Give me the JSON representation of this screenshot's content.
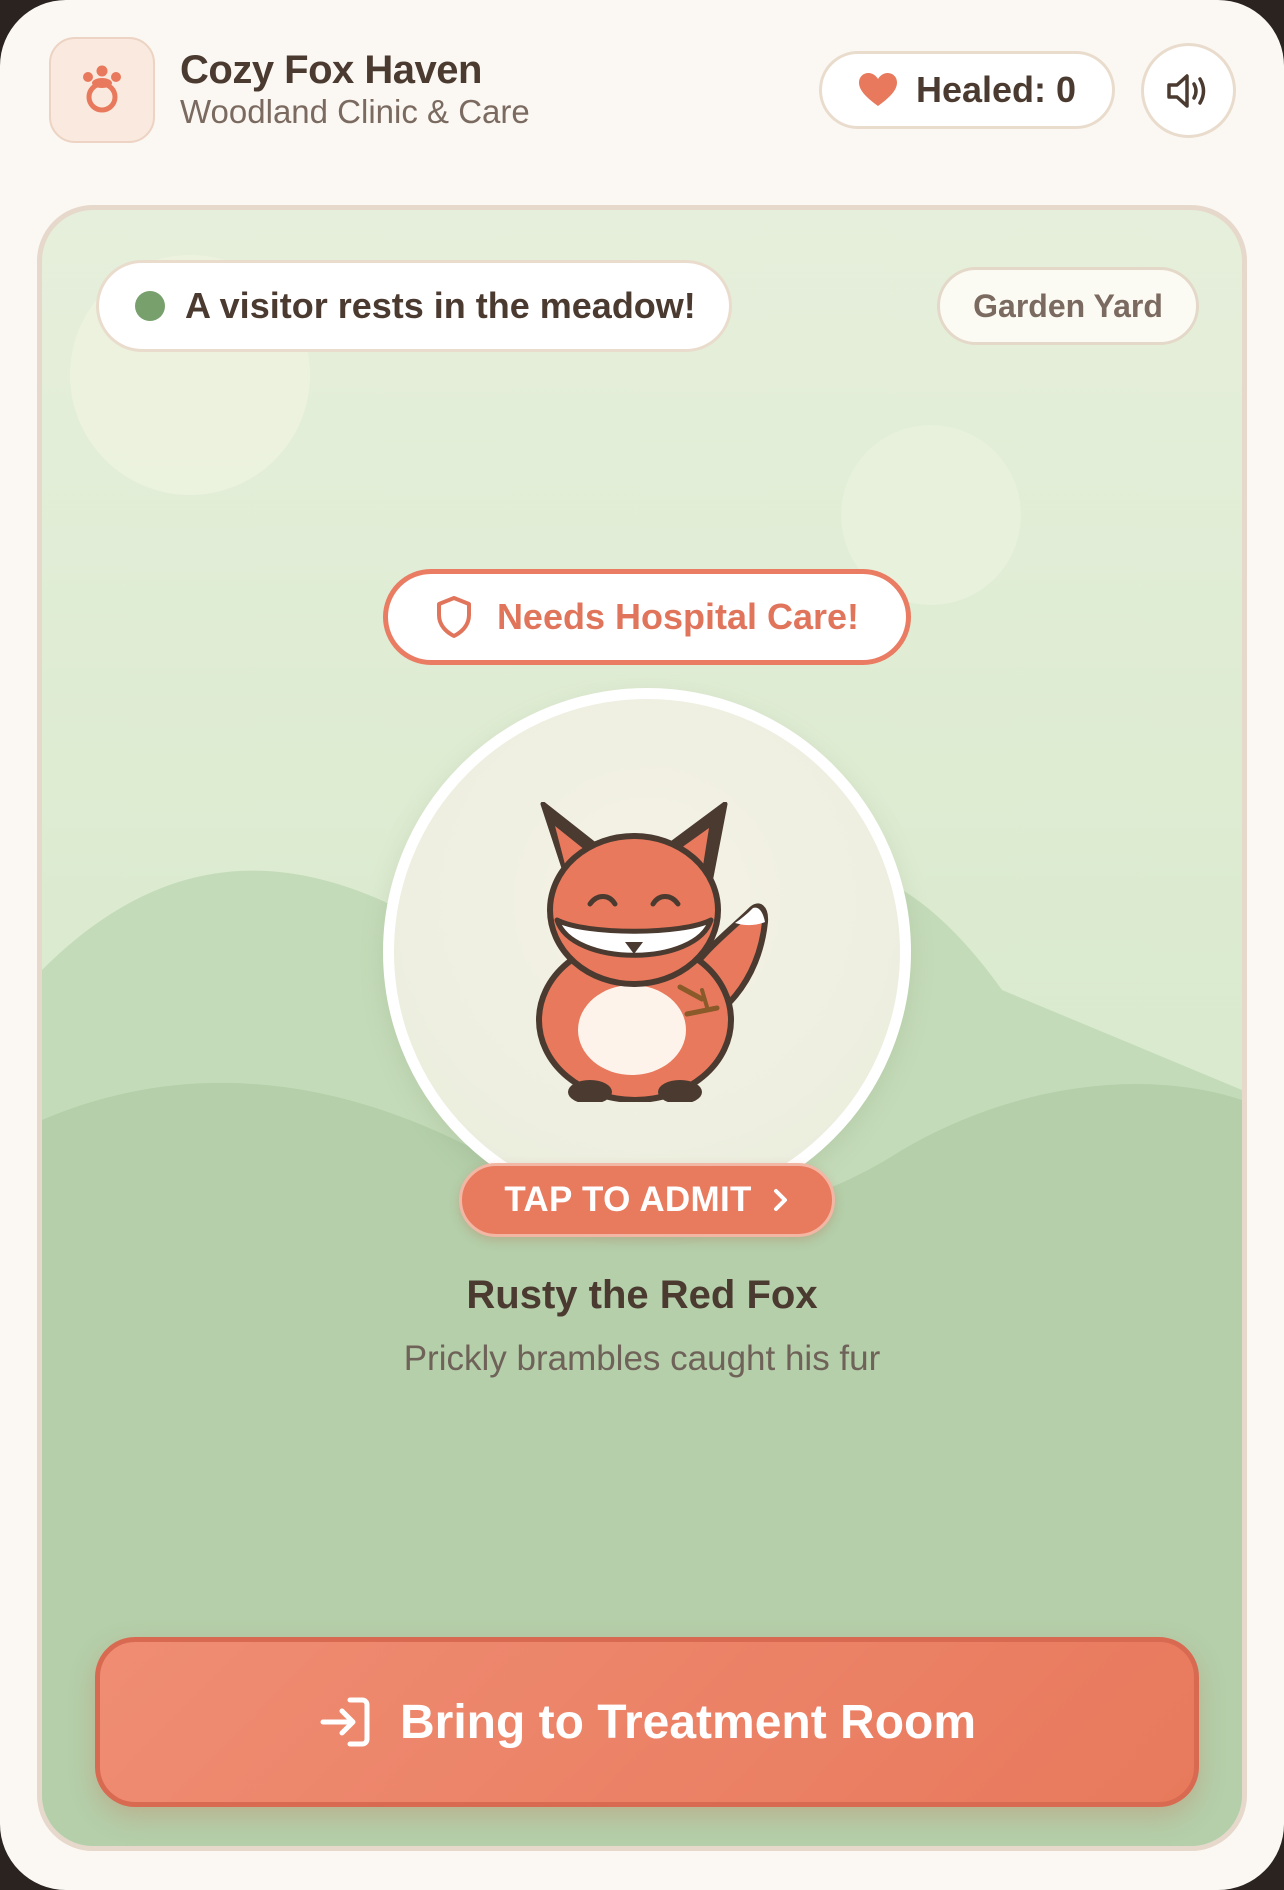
{
  "header": {
    "title": "Cozy Fox Haven",
    "subtitle": "Woodland Clinic & Care",
    "logo_icon": "paw-icon",
    "healed_label": "Healed: 0",
    "healed_count": 0,
    "healed_icon": "heart-icon",
    "sound_icon": "speaker-icon"
  },
  "scene": {
    "status_text": "A visitor rests in the meadow!",
    "location": "Garden Yard",
    "alert_text": "Needs Hospital Care!",
    "alert_icon": "shield-icon",
    "admit_label": "TAP TO ADMIT",
    "patient": {
      "name": "Rusty the Red Fox",
      "ailment": "Prickly brambles caught his fur",
      "sprite": "red-fox-icon"
    },
    "action_label": "Bring to Treatment Room",
    "action_icon": "enter-icon"
  },
  "colors": {
    "accent": "#e87a5e",
    "text_dark": "#4a3a30",
    "meadow": "#b4cfaa",
    "status_dot": "#77a06c"
  }
}
